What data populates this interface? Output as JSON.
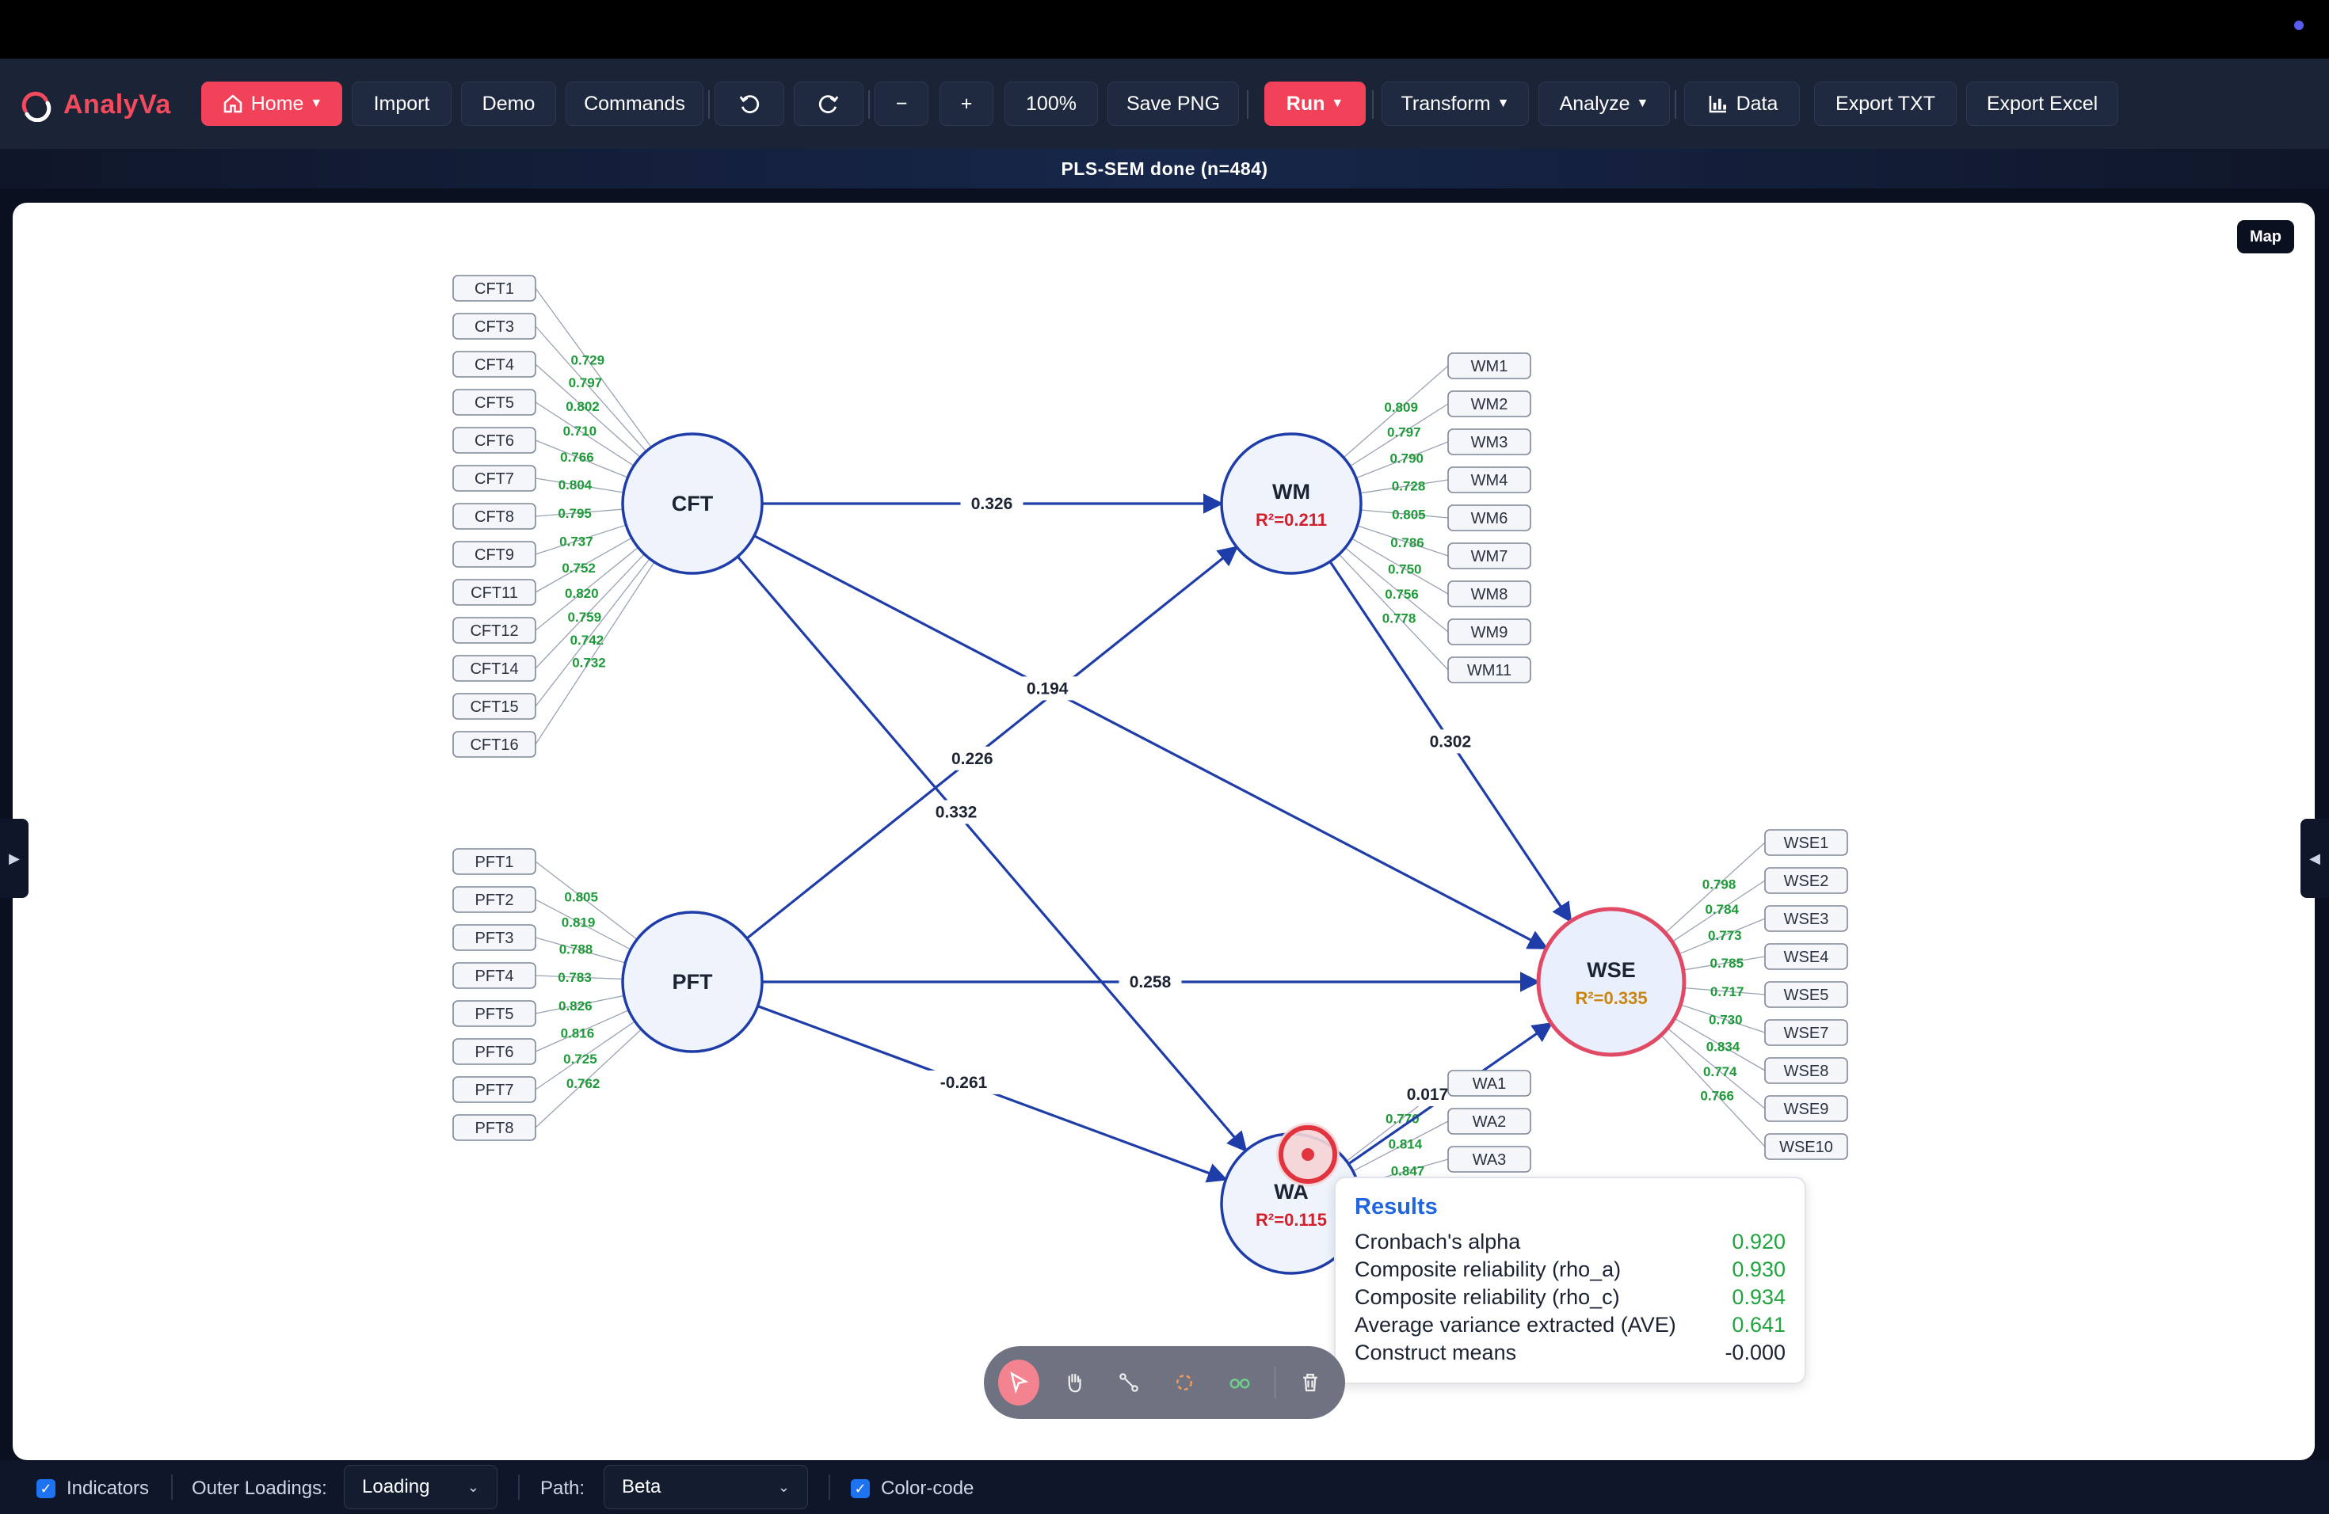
{
  "app": {
    "name_part1": "Analy",
    "name_part2": "Va"
  },
  "toolbar": {
    "home_label": "Home",
    "import_label": "Import",
    "demo_label": "Demo",
    "commands_label": "Commands",
    "undo_icon": "undo-icon",
    "redo_icon": "redo-icon",
    "zoom_out_label": "−",
    "zoom_in_label": "+",
    "zoom_level": "100%",
    "save_png_label": "Save PNG",
    "run_label": "Run",
    "transform_label": "Transform",
    "analyze_label": "Analyze",
    "data_label": "Data",
    "export_txt_label": "Export TXT",
    "export_excel_label": "Export Excel"
  },
  "status": {
    "text": "PLS-SEM done (n=484)"
  },
  "canvas": {
    "map_label": "Map"
  },
  "colors": {
    "accent": "#f2425a",
    "path_line": "#1f3da8",
    "node_fill": "#eef3fc",
    "node_stroke": "#1f3da8",
    "target_stroke": "#e04a65",
    "loading_green": "#1f9a3a",
    "r2_red": "#d21f2b",
    "r2_orange": "#c98510"
  },
  "diagram": {
    "constructs": [
      {
        "id": "CFT",
        "label": "CFT",
        "r2": ""
      },
      {
        "id": "WM",
        "label": "WM",
        "r2": "R²=0.211"
      },
      {
        "id": "PFT",
        "label": "PFT",
        "r2": ""
      },
      {
        "id": "WSE",
        "label": "WSE",
        "r2": "R²=0.335"
      },
      {
        "id": "WA",
        "label": "WA",
        "r2": "R²=0.115"
      }
    ],
    "indicators": {
      "CFT": [
        "CFT1",
        "CFT3",
        "CFT4",
        "CFT5",
        "CFT6",
        "CFT7",
        "CFT8",
        "CFT9",
        "CFT11",
        "CFT12",
        "CFT14",
        "CFT15",
        "CFT16"
      ],
      "PFT": [
        "PFT1",
        "PFT2",
        "PFT3",
        "PFT4",
        "PFT5",
        "PFT6",
        "PFT7",
        "PFT8"
      ],
      "WM": [
        "WM1",
        "WM2",
        "WM3",
        "WM4",
        "WM6",
        "WM7",
        "WM8",
        "WM9",
        "WM11"
      ],
      "WSE": [
        "WSE1",
        "WSE2",
        "WSE3",
        "WSE4",
        "WSE5",
        "WSE7",
        "WSE8",
        "WSE9",
        "WSE10"
      ],
      "WA": [
        "WA1",
        "WA2",
        "WA3"
      ]
    },
    "loadings": {
      "CFT": [
        "0.729",
        "0.797",
        "0.802",
        "0.710",
        "0.766",
        "0.804",
        "0.795",
        "0.737",
        "0.752",
        "0.820",
        "0.759",
        "0.742",
        "0.732"
      ],
      "PFT": [
        "0.805",
        "0.819",
        "0.788",
        "0.783",
        "0.826",
        "0.816",
        "0.725",
        "0.762"
      ],
      "WM": [
        "0.809",
        "0.797",
        "0.790",
        "0.728",
        "0.805",
        "0.786",
        "0.750",
        "0.756",
        "0.778"
      ],
      "WSE": [
        "0.798",
        "0.784",
        "0.773",
        "0.785",
        "0.717",
        "0.730",
        "0.834",
        "0.774",
        "0.766"
      ],
      "WA": [
        "0.770",
        "0.814",
        "0.847"
      ]
    },
    "paths": [
      {
        "from": "CFT",
        "to": "WM",
        "beta": "0.326"
      },
      {
        "from": "PFT",
        "to": "WM",
        "beta": "0.226"
      },
      {
        "from": "CFT",
        "to": "WSE",
        "beta": "0.194"
      },
      {
        "from": "WM",
        "to": "WSE",
        "beta": "0.302"
      },
      {
        "from": "CFT",
        "to": "WA",
        "beta": "0.332"
      },
      {
        "from": "PFT",
        "to": "WSE",
        "beta": "0.258"
      },
      {
        "from": "PFT",
        "to": "WA",
        "beta": "-0.261"
      },
      {
        "from": "WA",
        "to": "WSE",
        "beta": "0.017"
      }
    ]
  },
  "results_popup": {
    "title": "Results",
    "rows": [
      {
        "label": "Cronbach's alpha",
        "value": "0.920",
        "tone": "good"
      },
      {
        "label": "Composite reliability (rho_a)",
        "value": "0.930",
        "tone": "good"
      },
      {
        "label": "Composite reliability (rho_c)",
        "value": "0.934",
        "tone": "good"
      },
      {
        "label": "Average variance extracted (AVE)",
        "value": "0.641",
        "tone": "good"
      },
      {
        "label": "Construct means",
        "value": "-0.000",
        "tone": "neutral"
      }
    ]
  },
  "tools": [
    "pointer-icon",
    "hand-icon",
    "connect-icon",
    "rotate-icon",
    "glasses-icon",
    "trash-icon"
  ],
  "bottombar": {
    "indicators_label": "Indicators",
    "indicators_checked": true,
    "outer_loadings_label": "Outer Loadings:",
    "outer_loadings_value": "Loading",
    "path_label": "Path:",
    "path_value": "Beta",
    "color_code_label": "Color-code",
    "color_code_checked": true
  }
}
